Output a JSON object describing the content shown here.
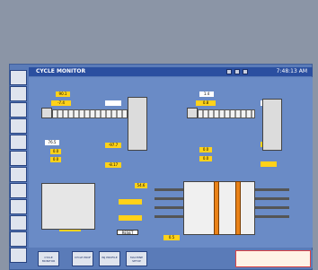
{
  "window": {
    "title": "CYCLE MONITOR",
    "time": "7:48:13 AM"
  },
  "left": {
    "top_val": "90.1",
    "top_val_label": "",
    "readout_1": "-7.4",
    "readout_2": "",
    "readout_3": "-97.7",
    "readout_4": "-8.17",
    "big_val": "76.5",
    "big_val_label": "",
    "sub_1": "0.0",
    "sub_2": "0.0",
    "bottom_val": "71"
  },
  "center": {
    "box_1": "54.6",
    "box_2": "",
    "box_3": "",
    "reset_label": "RESET"
  },
  "right": {
    "top_val": "1.4",
    "readout_1": "0.8",
    "readout_2": "",
    "readout_3": "-2.40",
    "readout_4": "",
    "box_1": "0.0",
    "box_2": "0.0",
    "bottom_val": "0.5"
  },
  "bottom_buttons": [
    {
      "label": "CYCLE MONITOR"
    },
    {
      "label": "CYCLE PROF"
    },
    {
      "label": "INJ PROFILE"
    },
    {
      "label": "MACHINE SETUP"
    }
  ],
  "alarm_text": "",
  "sidebar_icons": [
    "move-icon",
    "stop-icon",
    "mold-icon",
    "sequence-icon",
    "hand-icon",
    "lock-icon",
    "info-icon",
    "settings-icon",
    "screen-icon",
    "aux-icon",
    "chart-icon",
    "power-icon"
  ]
}
